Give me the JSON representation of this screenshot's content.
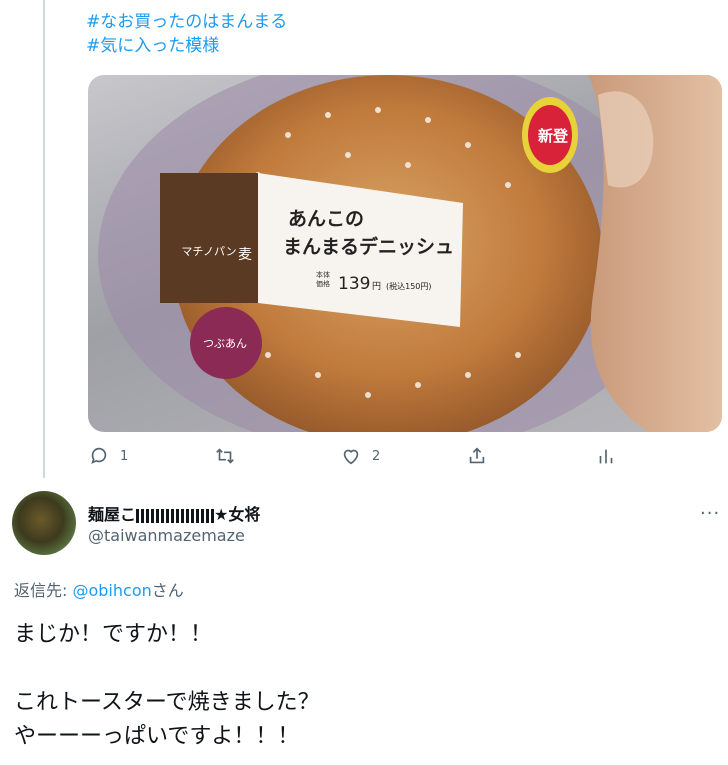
{
  "tweet": {
    "hashtags": [
      "#なお買ったのはまんまる",
      "#気に入った模様"
    ],
    "photo": {
      "label_title_line1": "あんこの",
      "label_title_line2": "まんまるデニッシュ",
      "brand": "マチノパン",
      "brand_mark": "麦",
      "price_caption_1": "本体",
      "price_caption_2": "価格",
      "price": "139",
      "price_unit": "円",
      "price_tax": "(税込150円)",
      "sticker": "つぶあん",
      "new_badge": "新登"
    },
    "actions": {
      "reply_count": "1",
      "retweet_count": "",
      "like_count": "2"
    }
  },
  "reply_tweet": {
    "display_name": "麺屋こ",
    "name_suffix": "★女将",
    "handle": "@taiwanmazemaze",
    "more_label": "···",
    "replying_to_prefix": "返信先: ",
    "replying_to_handle": "@obihcon",
    "replying_to_suffix": "さん",
    "text": "まじか！ですか！！\n\nこれトースターで焼きました？\nやーーーっぱいですよ！！！"
  },
  "colors": {
    "accent": "#1d9bf0",
    "muted": "#536471",
    "thread": "#cfd9de"
  }
}
